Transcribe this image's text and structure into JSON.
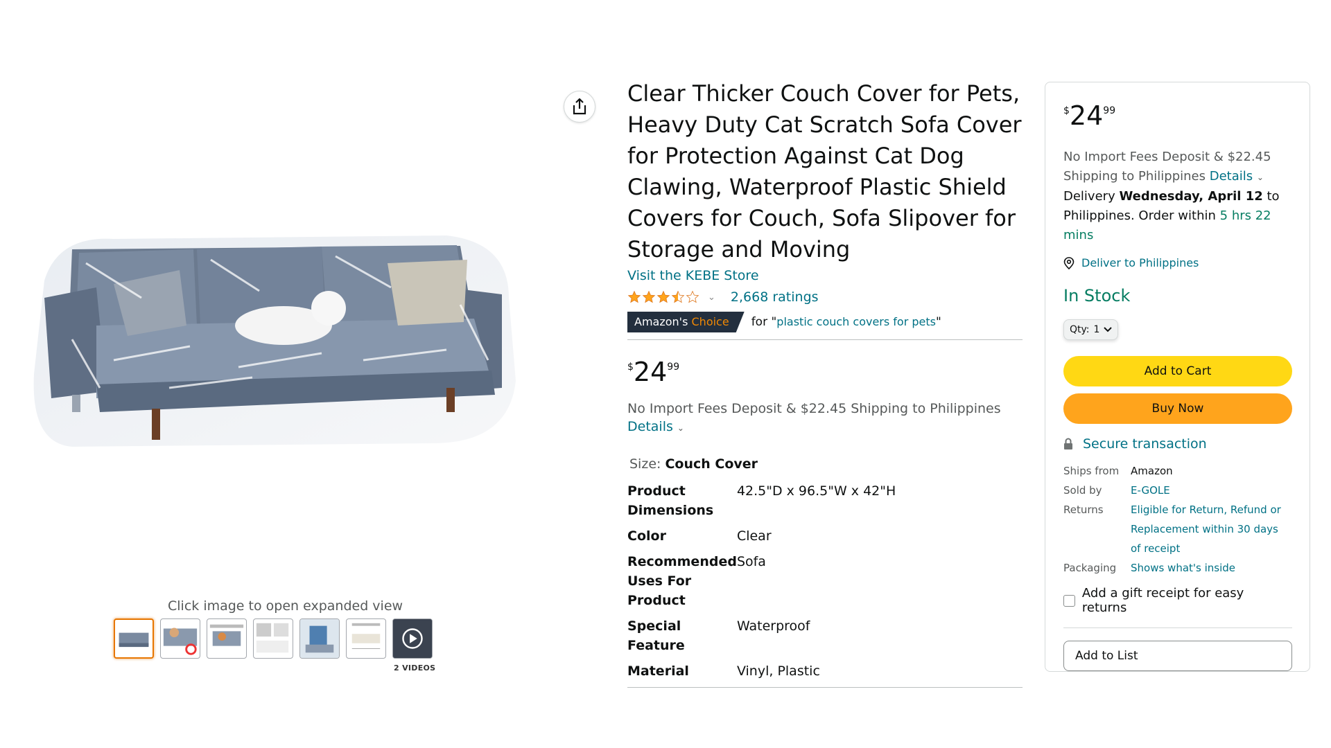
{
  "product": {
    "title": "Clear Thicker Couch Cover for Pets, Heavy Duty Cat Scratch Sofa Cover for Protection Against Cat Dog Clawing, Waterproof Plastic Shield Covers for Couch, Sofa Slipover for Storage and Moving",
    "store_link": "Visit the KEBE Store",
    "rating_stars": 3.5,
    "ratings_count": "2,668 ratings",
    "badge_prefix": "Amazon's",
    "badge_choice": "Choice",
    "badge_for": "for \"",
    "badge_query": "plastic couch covers for pets",
    "badge_close": "\""
  },
  "price": {
    "currency": "$",
    "whole": "24",
    "fraction": "99",
    "fees_line": "No Import Fees Deposit & $22.45 Shipping to Philippines",
    "details": "Details"
  },
  "size": {
    "label": "Size:",
    "value": "Couch Cover"
  },
  "specs": [
    {
      "key": "Product Dimensions",
      "value": "42.5\"D x 96.5\"W x 42\"H"
    },
    {
      "key": "Color",
      "value": "Clear"
    },
    {
      "key": "Recommended Uses For Product",
      "value": "Sofa"
    },
    {
      "key": "Special Feature",
      "value": "Waterproof"
    },
    {
      "key": "Material",
      "value": "Vinyl, Plastic"
    }
  ],
  "gallery": {
    "hint": "Click image to open expanded view",
    "videos_label": "2 VIDEOS"
  },
  "buy_box": {
    "fees_1": "No Import Fees Deposit & $22.45",
    "fees_2": "Shipping to Philippines",
    "details": "Details",
    "delivery_prefix": "Delivery",
    "delivery_date": "Wednesday, April 12",
    "delivery_to": "to Philippines. Order within",
    "countdown": "5 hrs 22 mins",
    "deliver_to": "Deliver to Philippines",
    "stock": "In Stock",
    "qty_label": "Qty:",
    "qty_value": "1",
    "add_to_cart": "Add to Cart",
    "buy_now": "Buy Now",
    "secure": "Secure transaction",
    "ships_from_label": "Ships from",
    "ships_from": "Amazon",
    "sold_by_label": "Sold by",
    "sold_by": "E-GOLE",
    "returns_label": "Returns",
    "returns": "Eligible for Return, Refund or Replacement within 30 days of receipt",
    "packaging_label": "Packaging",
    "packaging": "Shows what's inside",
    "gift": "Add a gift receipt for easy returns",
    "add_to_list": "Add to List"
  },
  "colors": {
    "link": "#007185",
    "in_stock": "#067d62",
    "add_to_cart": "#ffd814",
    "buy_now": "#ffa41c",
    "star": "#ffa41c",
    "badge_bg": "#232f3e",
    "badge_choice": "#f08804"
  },
  "icons": [
    "share-icon",
    "star-icon",
    "chevron-down-icon",
    "location-pin-icon",
    "lock-icon",
    "play-icon"
  ]
}
